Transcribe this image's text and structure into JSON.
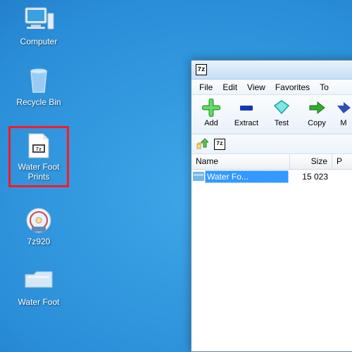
{
  "desktop": {
    "icons": [
      {
        "label": "Computer"
      },
      {
        "label": "Recycle Bin"
      },
      {
        "label": "Water Foot Prints"
      },
      {
        "label": "7z920"
      },
      {
        "label": "Water Foot"
      }
    ]
  },
  "app": {
    "icon_text": "7z",
    "menu": {
      "file": "File",
      "edit": "Edit",
      "view": "View",
      "favorites": "Favorites",
      "tools": "To"
    },
    "toolbar": {
      "add": "Add",
      "extract": "Extract",
      "test": "Test",
      "copy": "Copy",
      "move": "M"
    },
    "list": {
      "headers": {
        "name": "Name",
        "size": "Size",
        "p": "P"
      },
      "rows": [
        {
          "name": "Water Fo...",
          "size": "15 023"
        }
      ]
    }
  }
}
